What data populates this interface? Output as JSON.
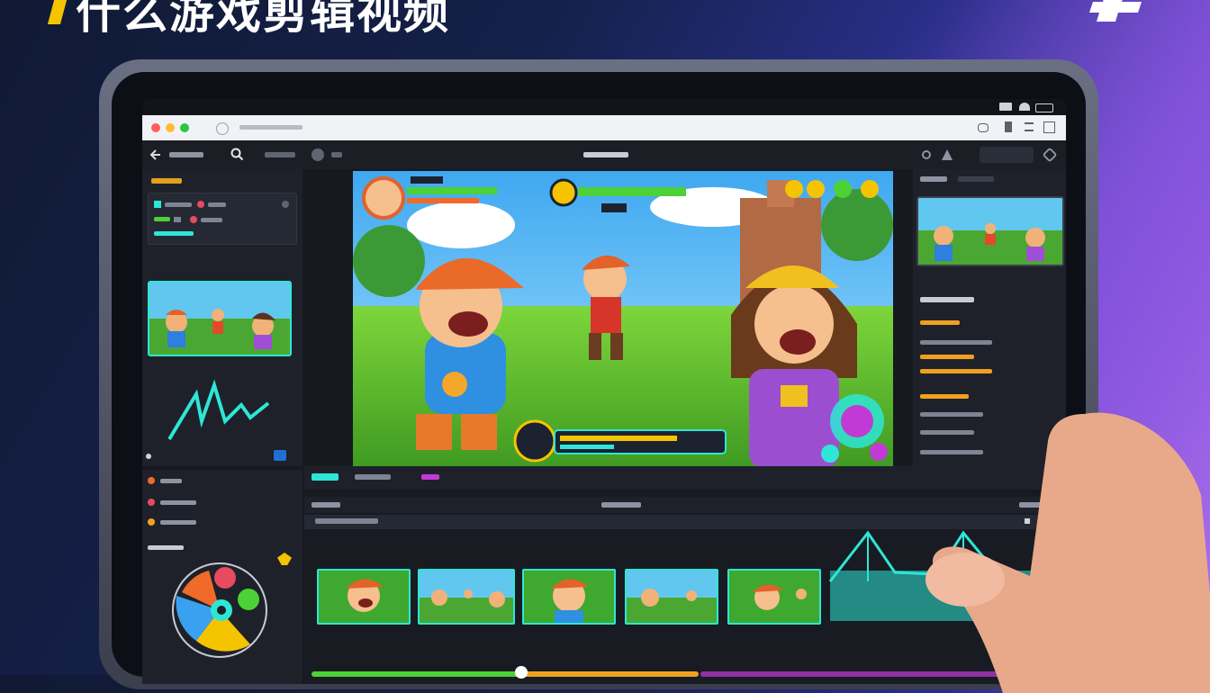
{
  "headline": {
    "title": "什么游戏剪辑视频"
  },
  "colors": {
    "accent": "#2ee6d6",
    "brand_yellow": "#f5c400",
    "bg_dark": "#101a34",
    "bg_purple": "#b573ef",
    "health_green": "#4cd137",
    "progress_orange": "#f0a020"
  },
  "icons": {
    "back": "arrow-left-icon",
    "search": "search-icon",
    "settings": "gear-icon",
    "play": "play-icon",
    "logo": "plus-logo-icon"
  },
  "timeline": {
    "clip_count": 5,
    "playhead_progress": 0.27
  }
}
